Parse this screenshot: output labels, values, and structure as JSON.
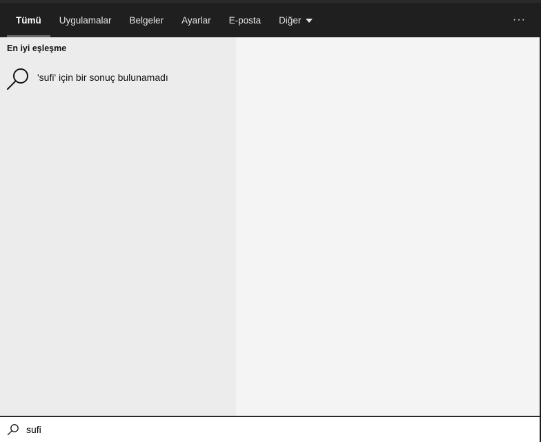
{
  "nav": {
    "tabs": [
      {
        "label": "Tümü",
        "active": true
      },
      {
        "label": "Uygulamalar",
        "active": false
      },
      {
        "label": "Belgeler",
        "active": false
      },
      {
        "label": "Ayarlar",
        "active": false
      },
      {
        "label": "E-posta",
        "active": false
      },
      {
        "label": "Diğer",
        "active": false
      }
    ],
    "more_label": "···"
  },
  "results": {
    "section_title": "En iyi eşleşme",
    "no_result_text": "'sufi' için bir sonuç bulunamadı",
    "icon": "search-icon"
  },
  "search": {
    "value": "sufi",
    "icon": "search-icon"
  },
  "colors": {
    "nav_background": "#1f1f1f",
    "left_pane": "#ececec",
    "right_pane": "#f4f4f4",
    "active_underline": "#6b6b6b"
  }
}
